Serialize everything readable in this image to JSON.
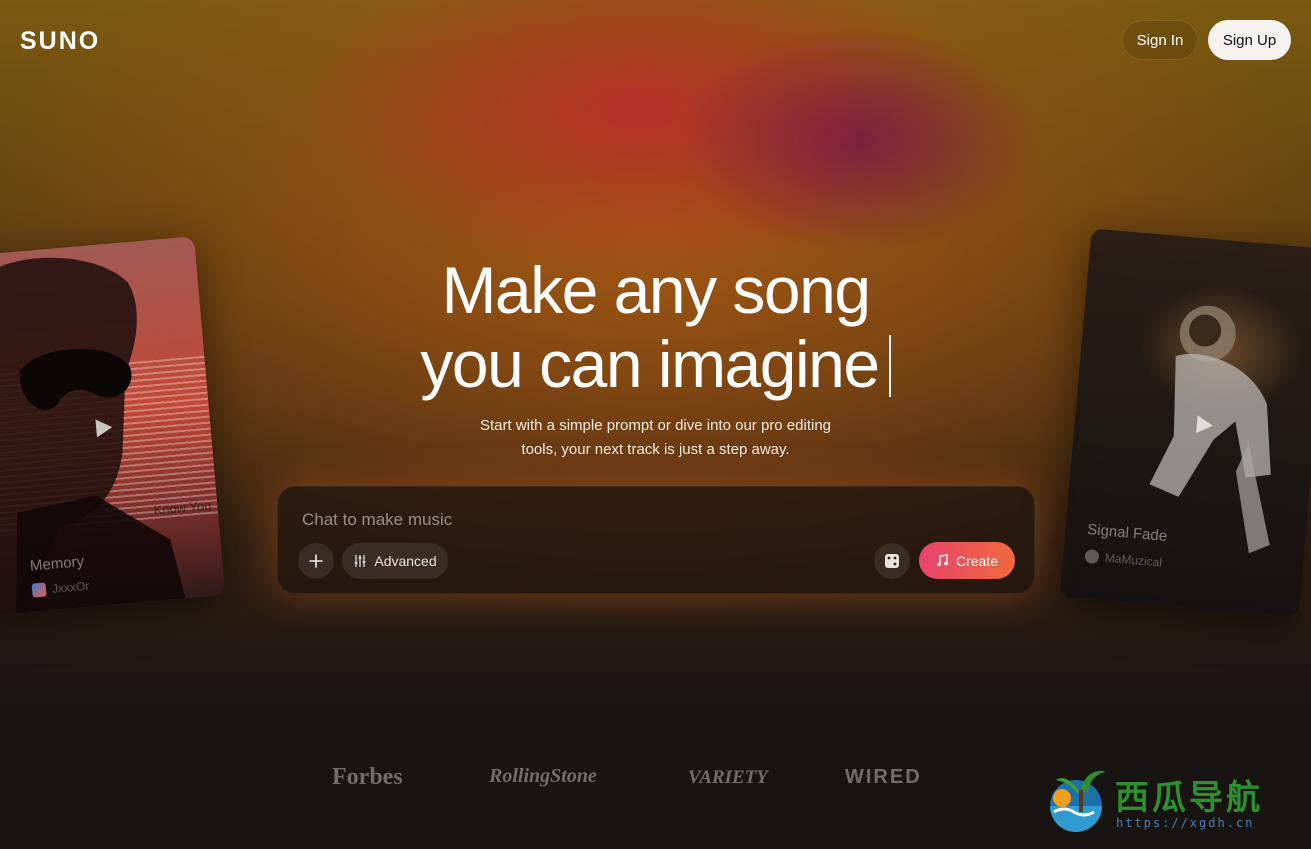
{
  "header": {
    "logo": "SUNO",
    "sign_in": "Sign In",
    "sign_up": "Sign Up"
  },
  "hero": {
    "line1": "Make any song",
    "line2": "you can imagine",
    "subtitle_line1": "Start with a simple prompt or dive into our pro editing",
    "subtitle_line2": "tools, your next track is just a step away."
  },
  "prompt": {
    "placeholder": "Chat to make music",
    "advanced_label": "Advanced",
    "create_label": "Create"
  },
  "cards": [
    {
      "title": "Memory",
      "author": "JxxxOr",
      "overlay_text": "Know You"
    },
    {
      "title": "Signal Fade",
      "author": "MaMuzical"
    }
  ],
  "press": [
    "Forbes",
    "RollingStone",
    "VARIETY",
    "WIRED"
  ],
  "watermark": {
    "text": "西瓜导航",
    "url": "https://xgdh.cn"
  },
  "colors": {
    "create_gradient_start": "#e8436e",
    "create_gradient_end": "#ef6a3a",
    "sign_up_bg": "#f5f3f0"
  }
}
